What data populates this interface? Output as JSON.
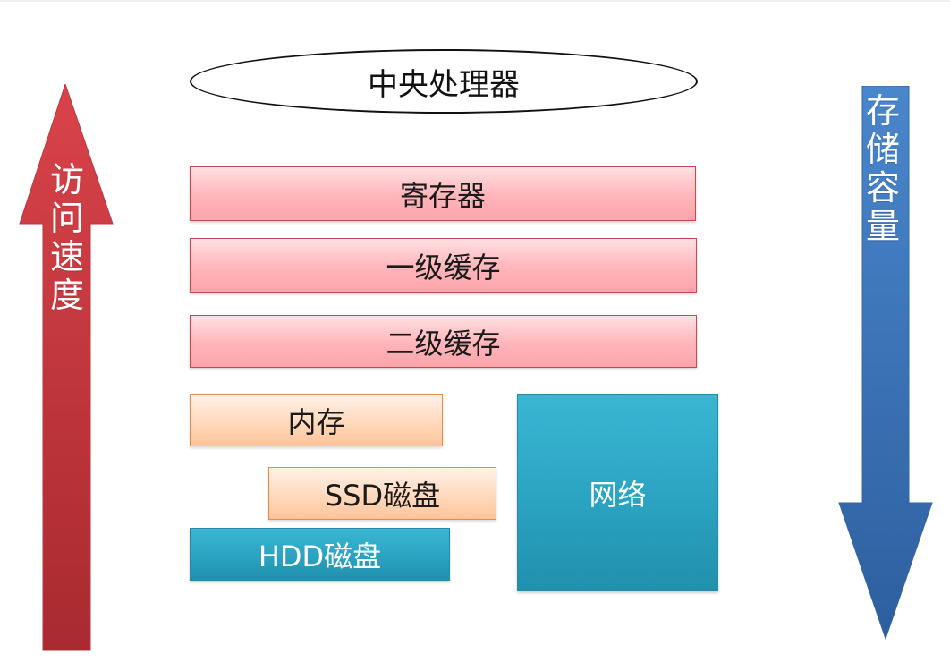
{
  "diagram": {
    "cpu_label": "中央处理器",
    "speed_arrow": {
      "label": "访问速度",
      "color": "#c8363d",
      "direction": "up"
    },
    "capacity_arrow": {
      "label": "存储容量",
      "color": "#3b74bd",
      "direction": "down"
    },
    "layers": {
      "register": "寄存器",
      "l1_cache": "一级缓存",
      "l2_cache": "二级缓存",
      "memory": "内存",
      "ssd": "SSD磁盘",
      "hdd": "HDD磁盘",
      "network": "网络"
    },
    "colors": {
      "cache": "#ffb5bb",
      "memory_ssd": "#ffd9bd",
      "hdd_network": "#2aa3c1"
    }
  }
}
